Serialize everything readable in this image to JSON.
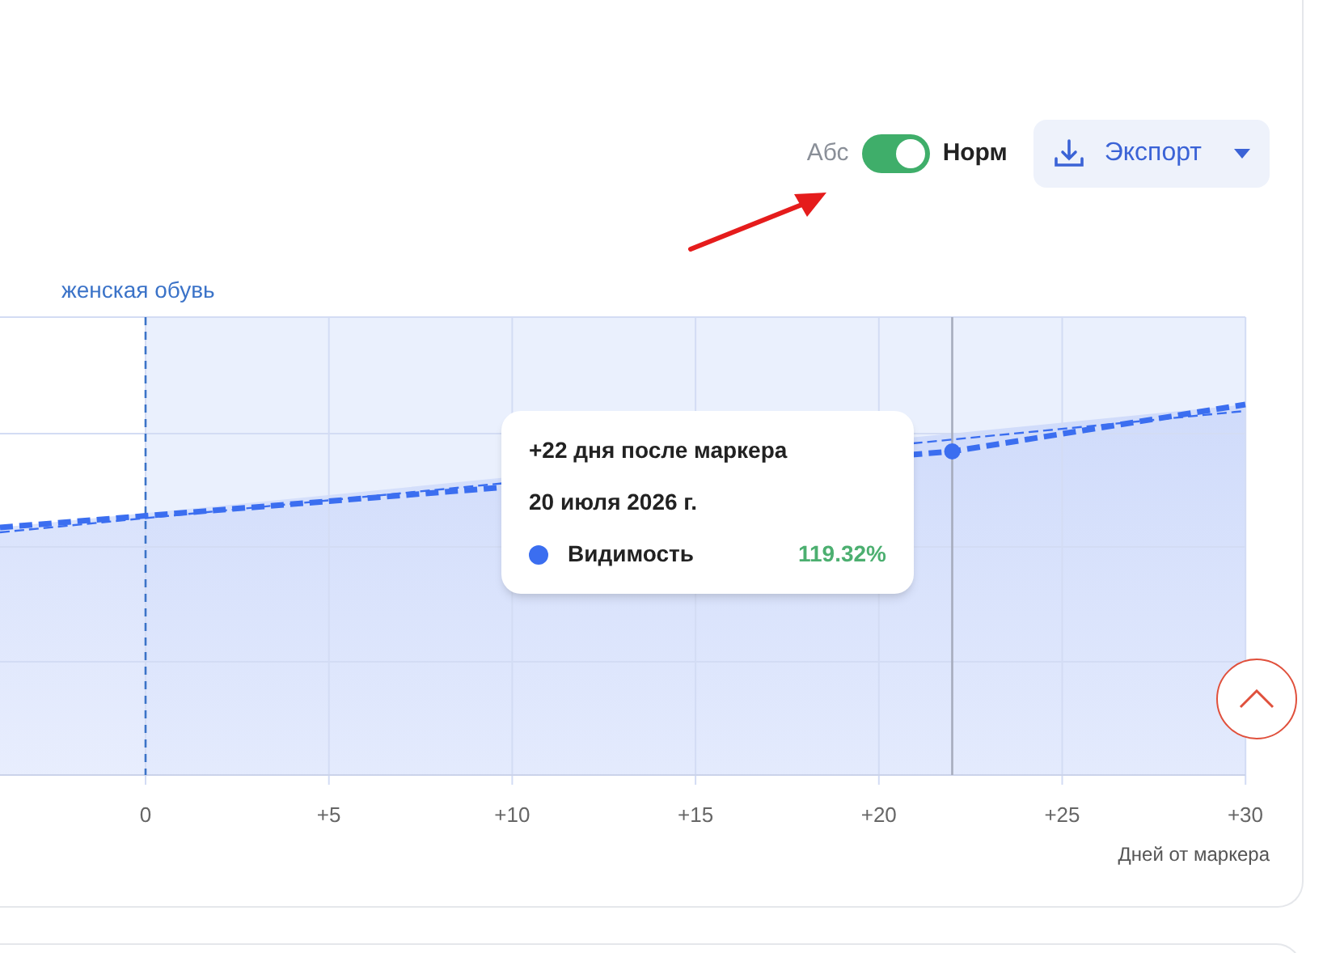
{
  "toggle": {
    "left_label": "Абс",
    "right_label": "Норм",
    "on": true
  },
  "export_button": {
    "label": "Экспорт"
  },
  "chart": {
    "marker_label": "женская обувь",
    "x_ticks": [
      "0",
      "+5",
      "+10",
      "+15",
      "+20",
      "+25",
      "+30"
    ],
    "x_axis_label": "Дней от маркера",
    "tooltip": {
      "title": "+22 дня после маркера",
      "date": "20 июля 2026 г.",
      "series": [
        {
          "name": "Видимость",
          "value": "119.32%",
          "color": "#3b6ef0"
        }
      ]
    }
  }
}
